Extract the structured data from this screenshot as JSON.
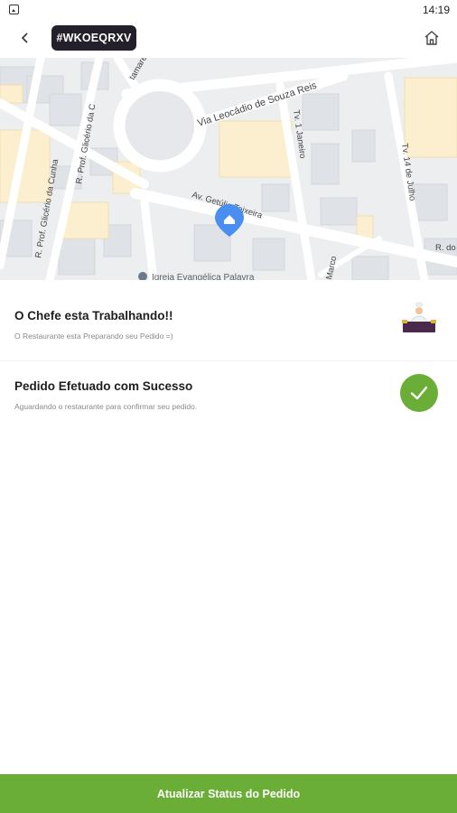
{
  "status_bar": {
    "time": "14:19"
  },
  "header": {
    "order_code": "#WKOEQRXV"
  },
  "map": {
    "streets": [
      "Via Leocádio de Souza Reis",
      "R. Prof. Glicério da Cunha",
      "R. Prof. Glicério da C",
      "Av. Getúlio Teixeira",
      "Tv. 1 Janeiro",
      "Tv. 14 de Julho",
      "Marco",
      "R. do",
      "tamaré"
    ],
    "poi": "Igreja Evangélica Palavra",
    "marker_color": "#4a8ff0"
  },
  "steps": [
    {
      "title": "O Chefe esta Trabalhando!!",
      "subtitle": "O Restaurante esta Preparando seu Pedido =)",
      "icon": "chef-icon"
    },
    {
      "title": "Pedido Efetuado com Sucesso",
      "subtitle": "Aguardando o restaurante para confirmar seu pedido.",
      "icon": "check-icon"
    }
  ],
  "footer": {
    "update_label": "Atualizar Status do Pedido"
  },
  "colors": {
    "accent": "#6aad37",
    "badge": "#231f2b",
    "chef_purple": "#4a2a4a"
  }
}
